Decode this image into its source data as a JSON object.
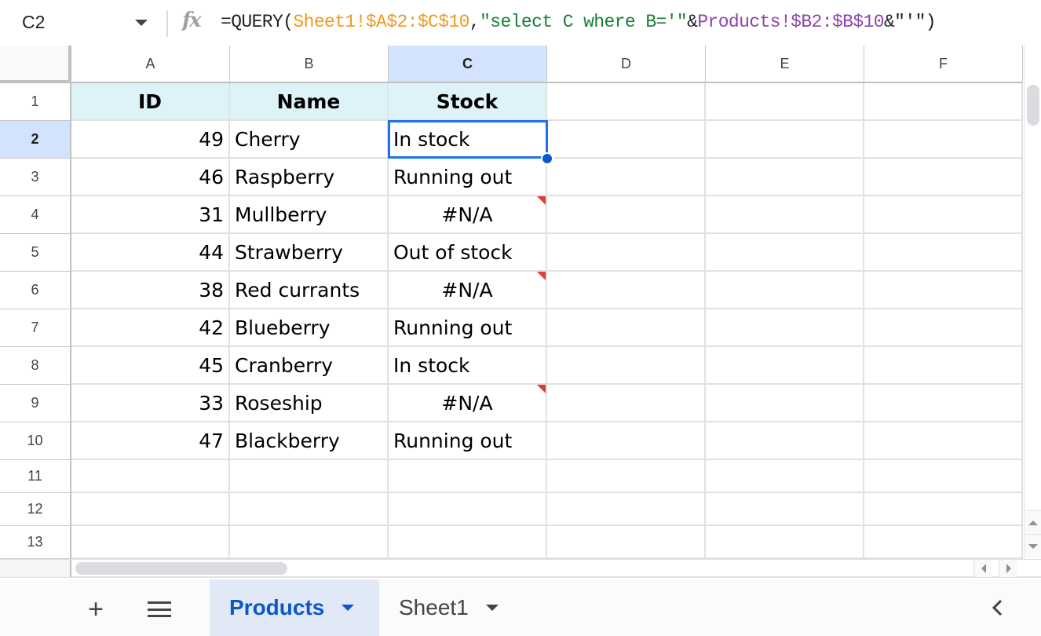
{
  "formula_bar": {
    "cell_ref": "C2",
    "fx_icon": "function-icon",
    "formula_parts": [
      {
        "text": "=QUERY(",
        "color": "default"
      },
      {
        "text": "Sheet1!$A$2:$C$10",
        "color": "orange"
      },
      {
        "text": ",",
        "color": "default"
      },
      {
        "text": "\"select C where B='\"",
        "color": "green"
      },
      {
        "text": "&",
        "color": "default"
      },
      {
        "text": "Products!$B2:$B$10",
        "color": "purple"
      },
      {
        "text": "&\"'\")",
        "color": "default"
      }
    ]
  },
  "columns": [
    "A",
    "B",
    "C",
    "D",
    "E",
    "F"
  ],
  "selected_column": "C",
  "rows": [
    "1",
    "2",
    "3",
    "4",
    "5",
    "6",
    "7",
    "8",
    "9",
    "10",
    "11",
    "12",
    "13"
  ],
  "selected_row": "2",
  "selected_cell": "C2",
  "table": {
    "headers": [
      "ID",
      "Name",
      "Stock"
    ],
    "rows": [
      {
        "id": "49",
        "name": "Cherry",
        "stock": "In stock",
        "error": false
      },
      {
        "id": "46",
        "name": "Raspberry",
        "stock": "Running out",
        "error": false
      },
      {
        "id": "31",
        "name": "Mullberry",
        "stock": "#N/A",
        "error": true
      },
      {
        "id": "44",
        "name": "Strawberry",
        "stock": "Out of stock",
        "error": false
      },
      {
        "id": "38",
        "name": "Red currants",
        "stock": "#N/A",
        "error": true
      },
      {
        "id": "42",
        "name": "Blueberry",
        "stock": "Running out",
        "error": false
      },
      {
        "id": "45",
        "name": "Cranberry",
        "stock": "In stock",
        "error": false
      },
      {
        "id": "33",
        "name": "Roseship",
        "stock": "#N/A",
        "error": true
      },
      {
        "id": "47",
        "name": "Blackberry",
        "stock": "Running out",
        "error": false
      }
    ]
  },
  "sheet_tabs": {
    "add_icon": "plus-icon",
    "menu_icon": "all-sheets-menu-icon",
    "tabs": [
      {
        "label": "Products",
        "active": true
      },
      {
        "label": "Sheet1",
        "active": false
      }
    ],
    "collapse_icon": "chevron-left-icon"
  },
  "colors": {
    "header_fill": "#def3f7",
    "selection": "#1a73e8",
    "error_flag": "#e53935",
    "active_tab": "#0b57d0"
  }
}
